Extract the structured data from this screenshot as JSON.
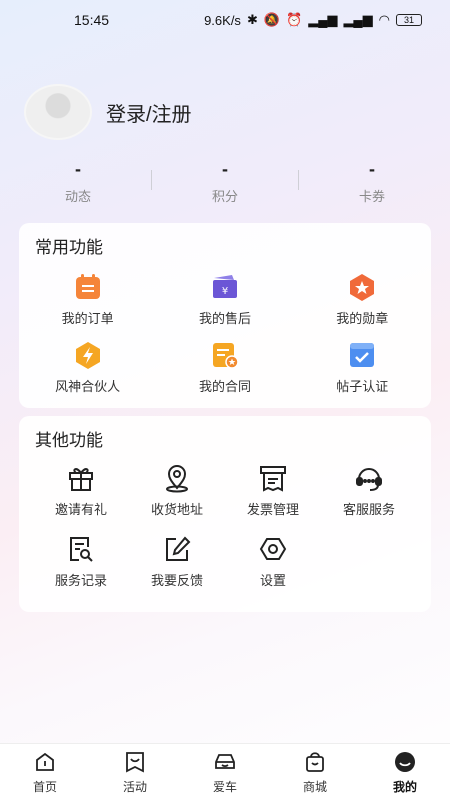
{
  "status_bar": {
    "time": "15:45",
    "speed": "9.6K/s",
    "battery": "31"
  },
  "profile": {
    "login_label": "登录/注册"
  },
  "stats": [
    {
      "value": "-",
      "label": "动态"
    },
    {
      "value": "-",
      "label": "积分"
    },
    {
      "value": "-",
      "label": "卡券"
    }
  ],
  "common": {
    "title": "常用功能",
    "items": [
      {
        "label": "我的订单",
        "icon": "order-icon"
      },
      {
        "label": "我的售后",
        "icon": "after-sales-icon"
      },
      {
        "label": "我的勋章",
        "icon": "medal-icon"
      },
      {
        "label": "风神合伙人",
        "icon": "partner-icon"
      },
      {
        "label": "我的合同",
        "icon": "contract-icon"
      },
      {
        "label": "帖子认证",
        "icon": "post-certify-icon"
      }
    ]
  },
  "other": {
    "title": "其他功能",
    "items": [
      {
        "label": "邀请有礼",
        "icon": "gift-icon"
      },
      {
        "label": "收货地址",
        "icon": "location-icon"
      },
      {
        "label": "发票管理",
        "icon": "invoice-icon"
      },
      {
        "label": "客服服务",
        "icon": "headset-icon"
      },
      {
        "label": "服务记录",
        "icon": "service-record-icon"
      },
      {
        "label": "我要反馈",
        "icon": "feedback-icon"
      },
      {
        "label": "设置",
        "icon": "settings-icon"
      }
    ]
  },
  "tabs": [
    {
      "label": "首页"
    },
    {
      "label": "活动"
    },
    {
      "label": "爱车"
    },
    {
      "label": "商城"
    },
    {
      "label": "我的"
    }
  ],
  "colors": {
    "orange": "#f5853a",
    "purple": "#6b56d6",
    "blue": "#4d8ef0",
    "yellow": "#f5a623"
  }
}
